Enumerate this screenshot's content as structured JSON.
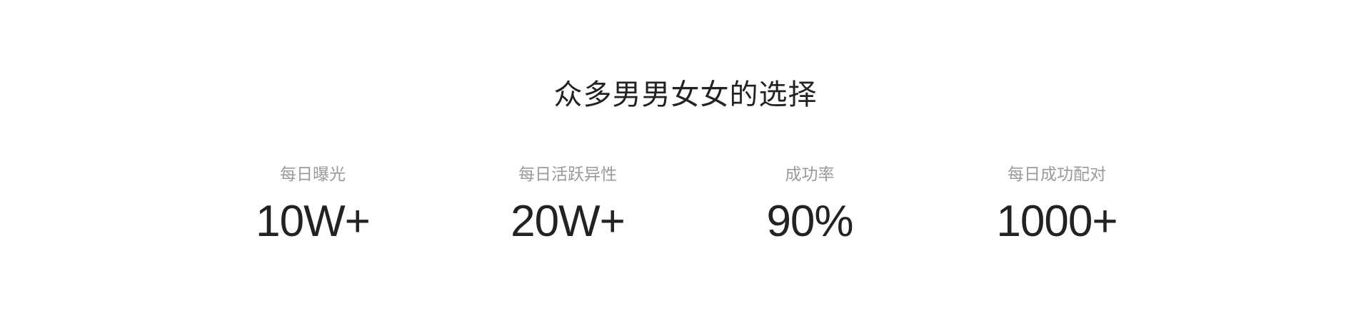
{
  "section": {
    "title": "众多男男女女的选择"
  },
  "stats": [
    {
      "label": "每日曝光",
      "value": "10W+"
    },
    {
      "label": "每日活跃异性",
      "value": "20W+"
    },
    {
      "label": "成功率",
      "value": "90%"
    },
    {
      "label": "每日成功配对",
      "value": "1000+"
    }
  ],
  "colors": {
    "background": "#ffffff",
    "title": "#222222",
    "label": "#9a9a9a",
    "value": "#222222"
  }
}
